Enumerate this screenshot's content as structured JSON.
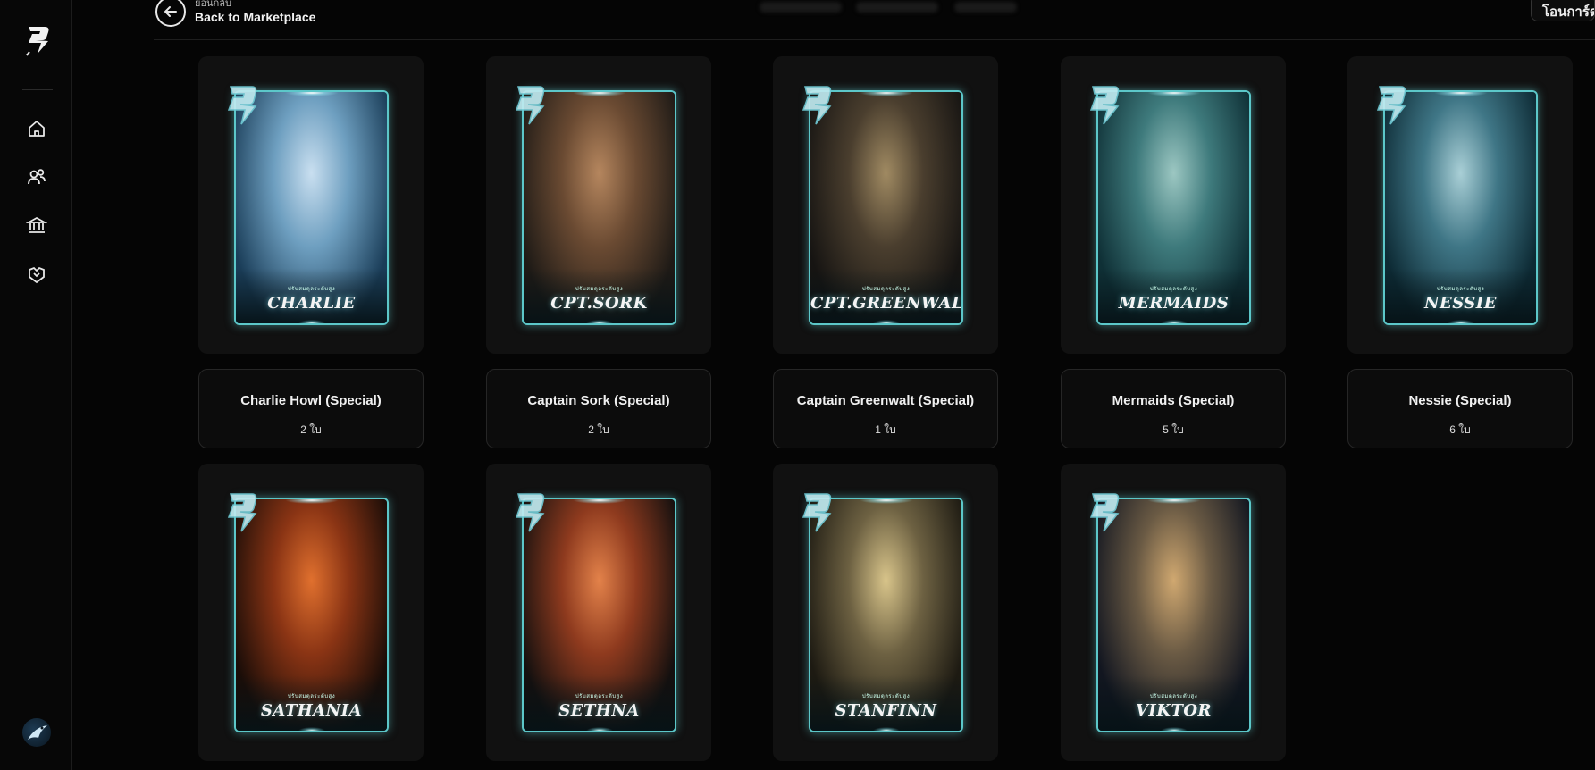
{
  "nav": {
    "items": [
      {
        "icon": "home-icon"
      },
      {
        "icon": "users-icon"
      },
      {
        "icon": "bank-icon"
      },
      {
        "icon": "handshake-icon"
      }
    ]
  },
  "header": {
    "back_sub": "ย้อนกลับ",
    "back_label": "Back to Marketplace",
    "right_button": "โอนการ์ด"
  },
  "cards": [
    {
      "card_name": "CHARLIE",
      "card_sub": "ปรับสมดุลระดับสูง",
      "title": "Charlie Howl (Special)",
      "count": "2 ใบ",
      "colors": [
        "#1a3d58",
        "#6e9fc0",
        "#c9dff0"
      ]
    },
    {
      "card_name": "CPT.SORK",
      "card_sub": "ปรับสมดุลระดับสูง",
      "title": "Captain Sork (Special)",
      "count": "2 ใบ",
      "colors": [
        "#1e1a16",
        "#6a4a32",
        "#b5865e"
      ]
    },
    {
      "card_name": "CPT.GREENWALT",
      "card_sub": "ปรับสมดุลระดับสูง",
      "title": "Captain Greenwalt (Special)",
      "count": "1 ใบ",
      "colors": [
        "#161412",
        "#4a3e2e",
        "#a08a62"
      ]
    },
    {
      "card_name": "MERMAIDS",
      "card_sub": "ปรับสมดุลระดับสูง",
      "title": "Mermaids (Special)",
      "count": "5 ใบ",
      "colors": [
        "#0f3036",
        "#3e7a7c",
        "#9cc7c2"
      ]
    },
    {
      "card_name": "NESSIE",
      "card_sub": "ปรับสมดุลระดับสูง",
      "title": "Nessie (Special)",
      "count": "6 ใบ",
      "colors": [
        "#0d2a34",
        "#3f7686",
        "#a9cfd6"
      ]
    },
    {
      "card_name": "SATHANIA",
      "card_sub": "ปรับสมดุลระดับสูง",
      "title": "",
      "count": "",
      "colors": [
        "#1a0d08",
        "#8a3414",
        "#e0702e"
      ]
    },
    {
      "card_name": "SETHNA",
      "card_sub": "ปรับสมดุลระดับสูง",
      "title": "",
      "count": "",
      "colors": [
        "#14100f",
        "#8e3a1e",
        "#e3824a"
      ]
    },
    {
      "card_name": "STANFINN",
      "card_sub": "ปรับสมดุลระดับสูง",
      "title": "",
      "count": "",
      "colors": [
        "#1d1a12",
        "#6d6142",
        "#d8c48a"
      ]
    },
    {
      "card_name": "VIKTOR",
      "card_sub": "ปรับสมดุลระดับสูง",
      "title": "",
      "count": "",
      "colors": [
        "#121620",
        "#6a5a44",
        "#d0a870"
      ]
    }
  ]
}
